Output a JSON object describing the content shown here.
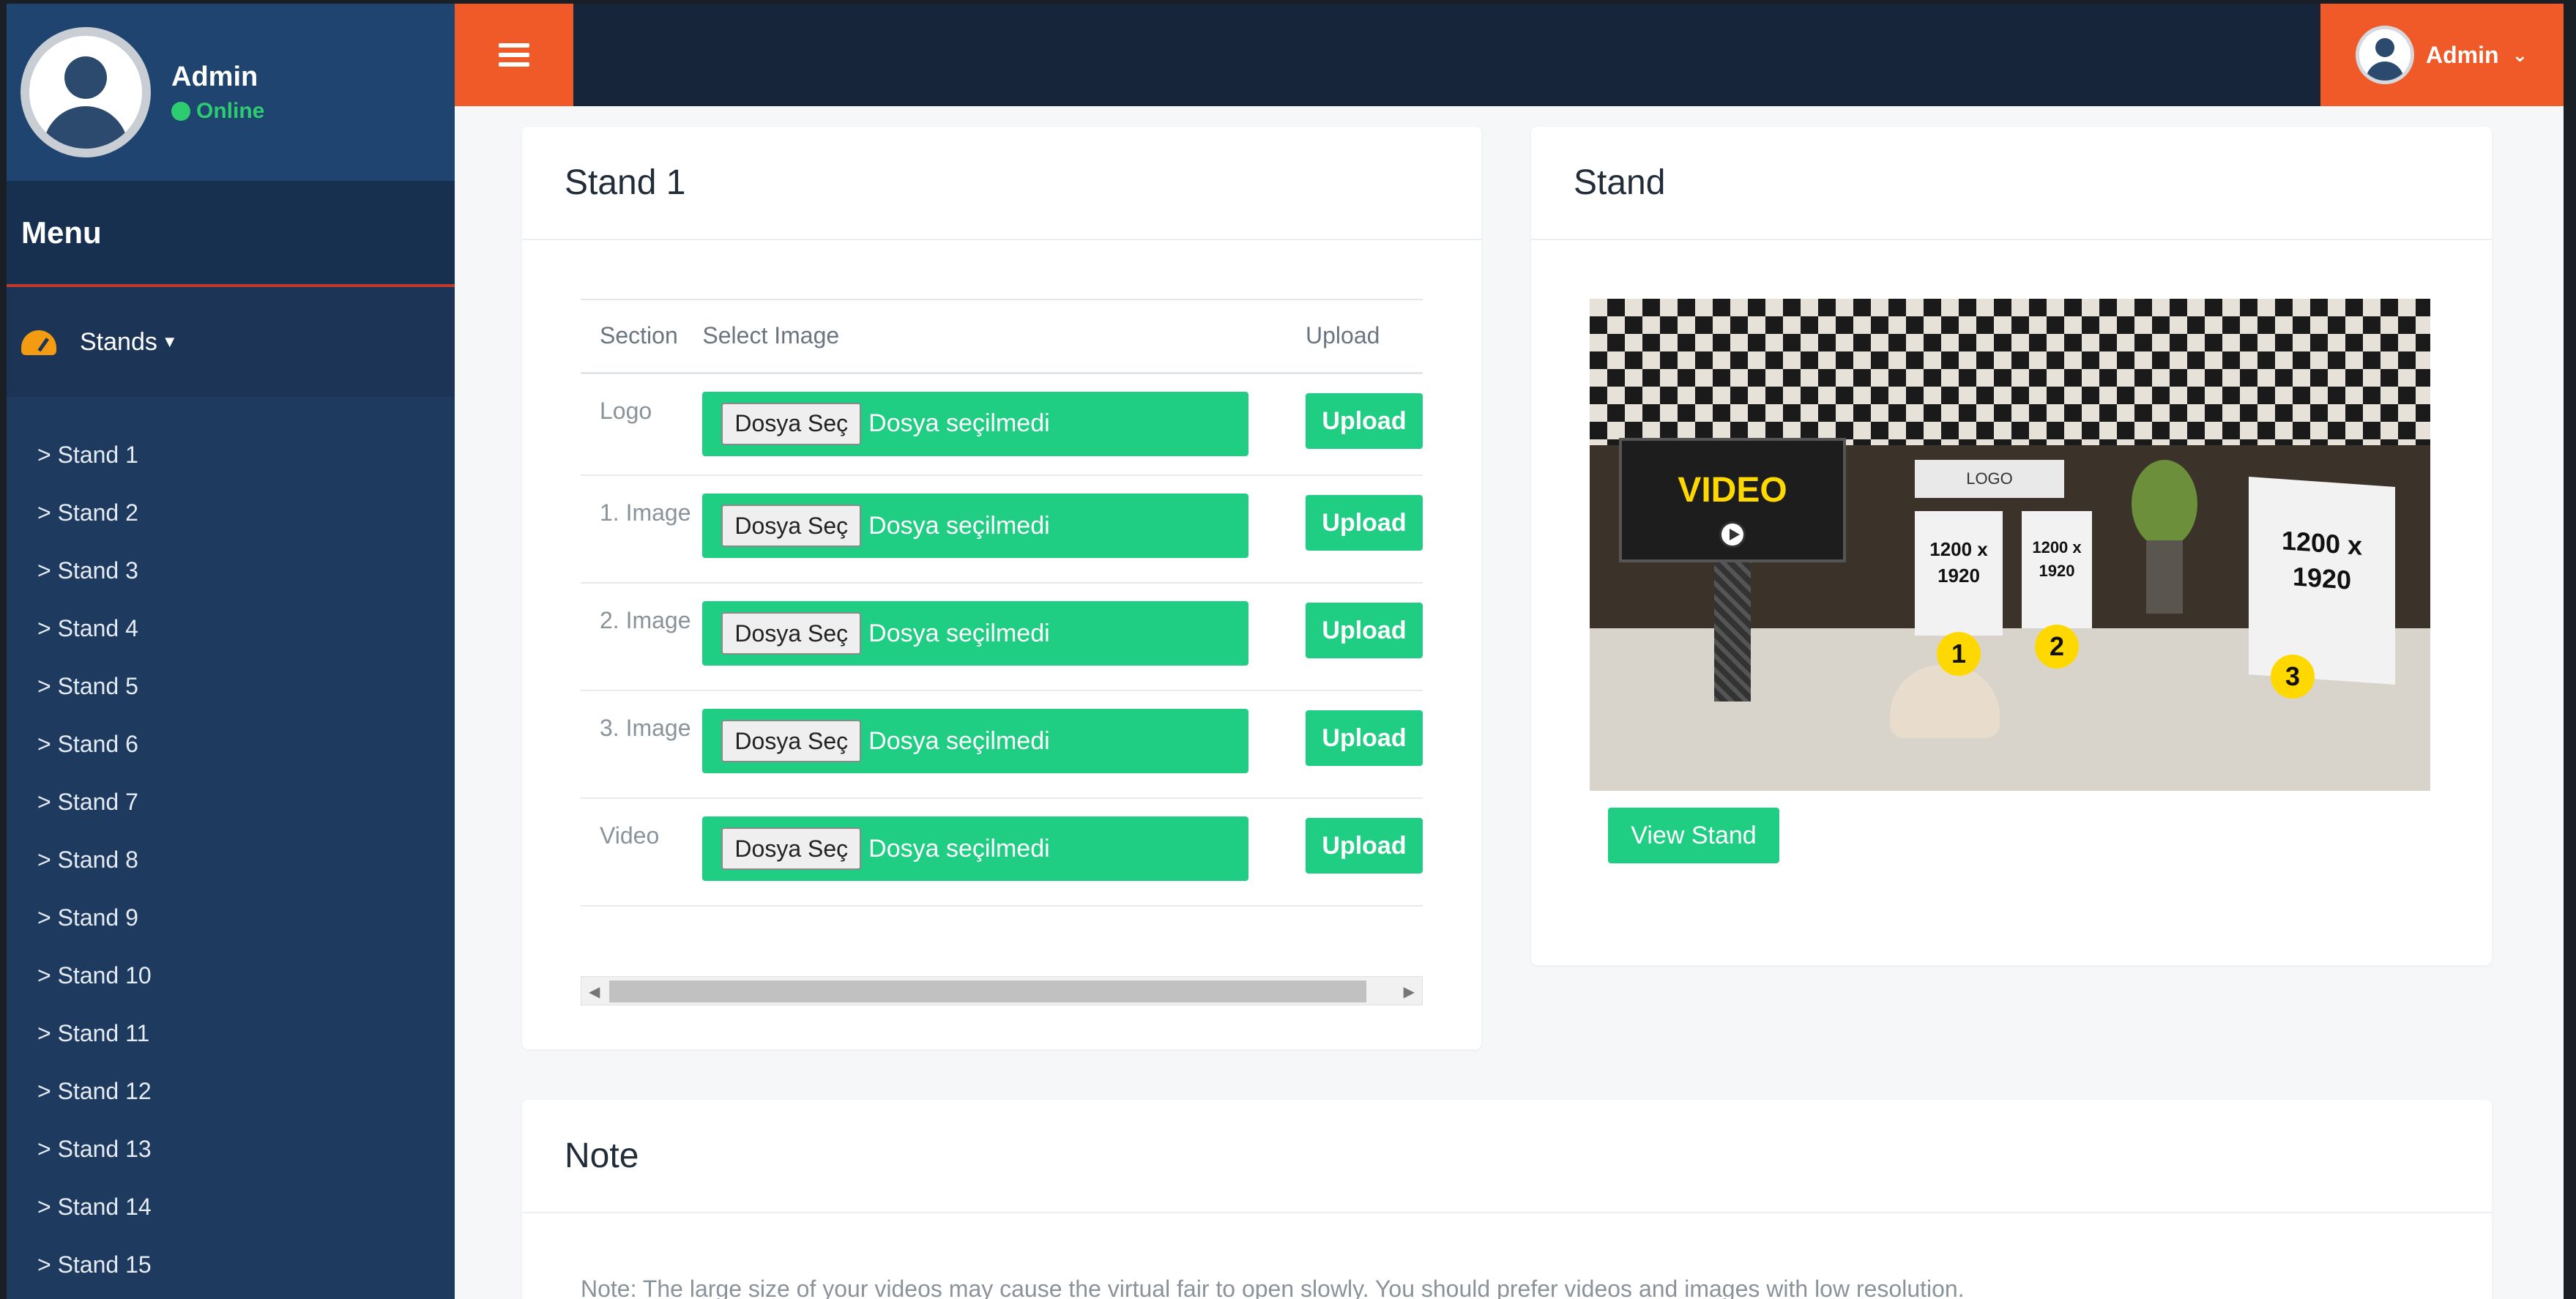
{
  "sidebar": {
    "user": {
      "name": "Admin",
      "status": "Online"
    },
    "menu_title": "Menu",
    "stands_label": "Stands",
    "stand_items": [
      "> Stand 1",
      "> Stand 2",
      "> Stand 3",
      "> Stand 4",
      "> Stand 5",
      "> Stand 6",
      "> Stand 7",
      "> Stand 8",
      "> Stand 9",
      "> Stand 10",
      "> Stand 11",
      "> Stand 12",
      "> Stand 13",
      "> Stand 14",
      "> Stand 15"
    ]
  },
  "topbar": {
    "user_label": "Admin"
  },
  "stand_card": {
    "title": "Stand 1",
    "headers": {
      "section": "Section",
      "select": "Select Image",
      "upload": "Upload"
    },
    "rows": [
      {
        "section": "Logo",
        "file_button": "Dosya Seç",
        "file_status": "Dosya seçilmedi",
        "upload": "Upload"
      },
      {
        "section": "1. Image",
        "file_button": "Dosya Seç",
        "file_status": "Dosya seçilmedi",
        "upload": "Upload"
      },
      {
        "section": "2. Image",
        "file_button": "Dosya Seç",
        "file_status": "Dosya seçilmedi",
        "upload": "Upload"
      },
      {
        "section": "3. Image",
        "file_button": "Dosya Seç",
        "file_status": "Dosya seçilmedi",
        "upload": "Upload"
      },
      {
        "section": "Video",
        "file_button": "Dosya Seç",
        "file_status": "Dosya seçilmedi",
        "upload": "Upload"
      }
    ]
  },
  "preview_card": {
    "title": "Stand",
    "image": {
      "video_label": "VIDEO",
      "logo_label": "LOGO",
      "panel_1": "1200 x 1920",
      "panel_2": "1200 x 1920",
      "panel_3": "1200 x 1920",
      "markers": [
        "1",
        "2",
        "3"
      ]
    },
    "view_button": "View Stand"
  },
  "note_card": {
    "title": "Note",
    "text": "Note: The large size of your videos may cause the virtual fair to open slowly. You should prefer videos and images with low resolution."
  },
  "colors": {
    "sidebar_bg": "#1e3a5f",
    "topbar_bg": "#16253a",
    "accent_orange": "#f05a28",
    "accent_green": "#1fcd83",
    "online_green": "#2ecc71"
  },
  "icons": {
    "menu_toggle": "hamburger-icon",
    "stands": "dashboard-gauge-icon",
    "user_menu": "chevron-down-icon"
  }
}
